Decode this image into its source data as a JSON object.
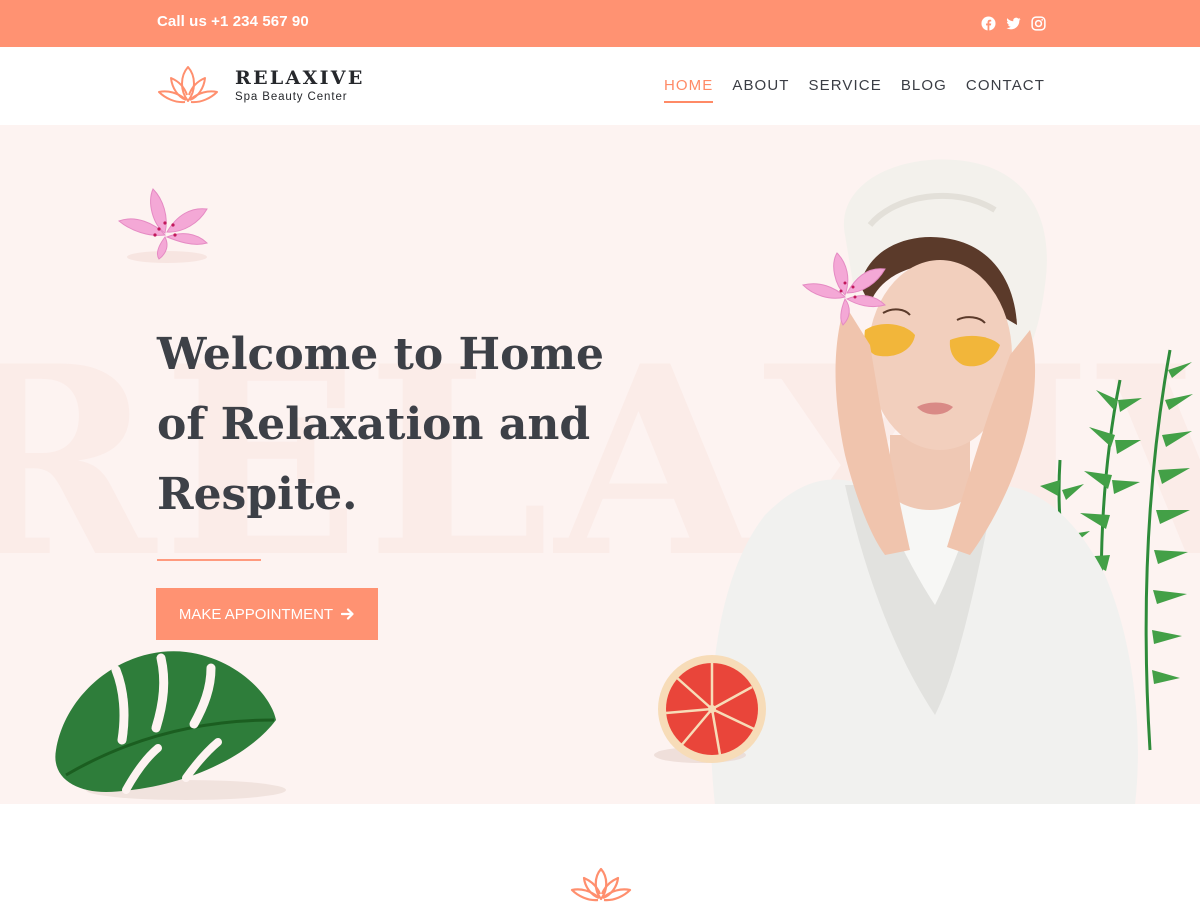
{
  "topbar": {
    "phone": "Call us +1 234 567 90",
    "social": [
      {
        "icon": "facebook-icon"
      },
      {
        "icon": "twitter-icon"
      },
      {
        "icon": "instagram-icon"
      }
    ]
  },
  "header": {
    "brand_name": "RELAXIVE",
    "brand_tagline": "Spa Beauty Center",
    "nav": [
      {
        "label": "HOME",
        "active": true
      },
      {
        "label": "ABOUT",
        "active": false
      },
      {
        "label": "SERVICE",
        "active": false
      },
      {
        "label": "BLOG",
        "active": false
      },
      {
        "label": "CONTACT",
        "active": false
      }
    ]
  },
  "hero": {
    "watermark": "RELAXIVE",
    "headline": "Welcome to Home of Relaxation and Respite.",
    "cta_label": "MAKE APPOINTMENT"
  },
  "colors": {
    "accent": "#ff9272",
    "hero_bg": "#fdf3f1",
    "heading": "#3d4047"
  }
}
